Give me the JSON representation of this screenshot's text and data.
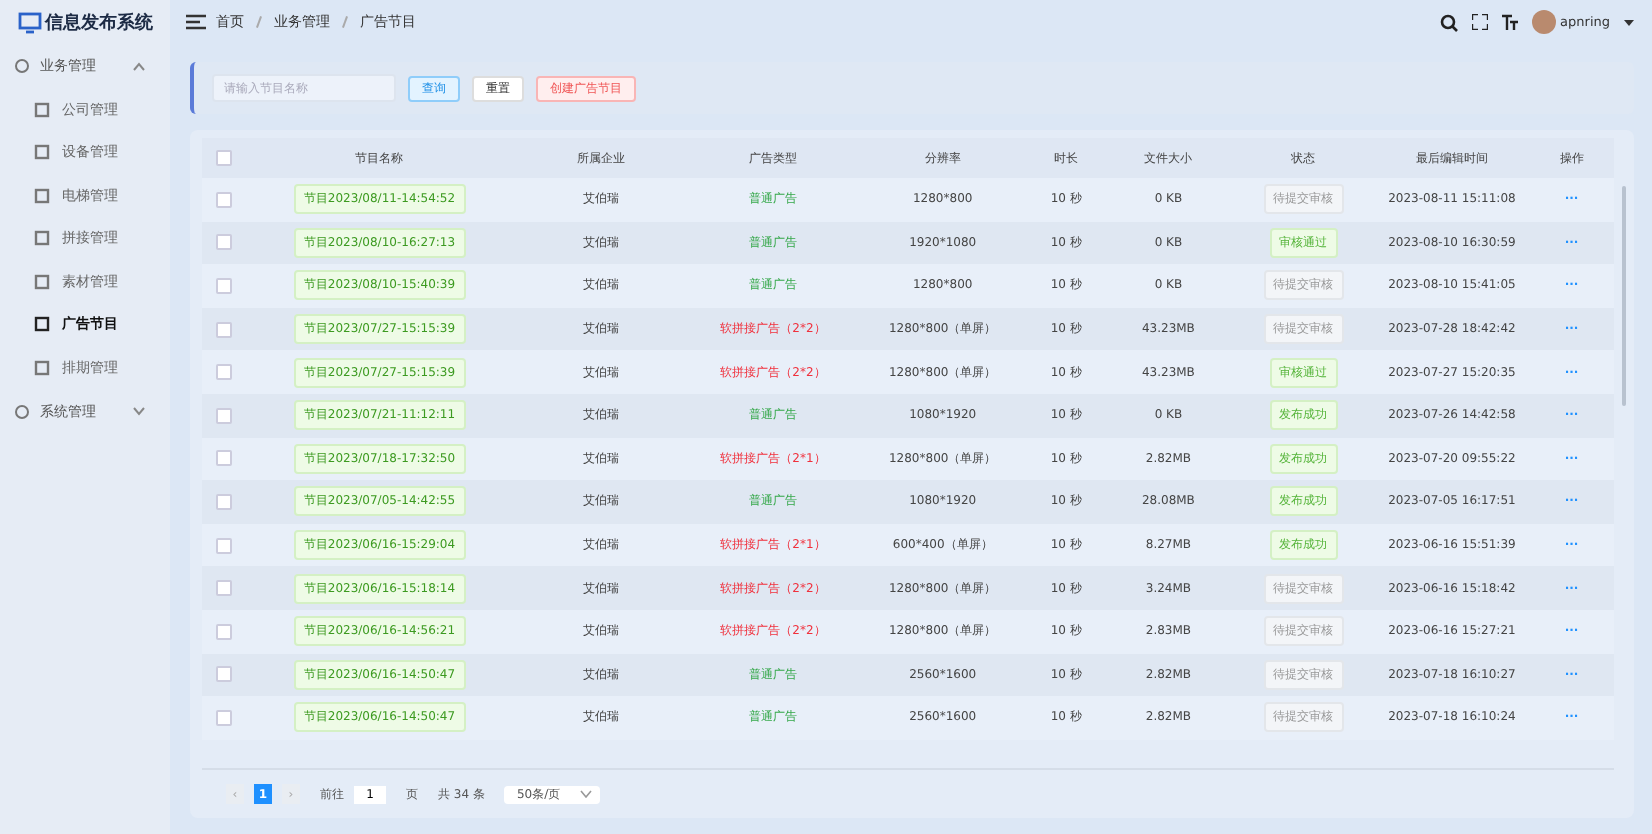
{
  "sidebar": {
    "title": "信息发布系统",
    "groups": [
      {
        "label": "业务管理",
        "expanded": true,
        "items": [
          {
            "label": "公司管理",
            "selected": false
          },
          {
            "label": "设备管理",
            "selected": false
          },
          {
            "label": "电梯管理",
            "selected": false
          },
          {
            "label": "拼接管理",
            "selected": false
          },
          {
            "label": "素材管理",
            "selected": false
          },
          {
            "label": "广告节目",
            "selected": true
          },
          {
            "label": "排期管理",
            "selected": false
          }
        ]
      },
      {
        "label": "系统管理",
        "expanded": false
      }
    ]
  },
  "header": {
    "breadcrumb": [
      "首页",
      "业务管理",
      "广告节目"
    ],
    "user": "apnring"
  },
  "search": {
    "placeholder": "请输入节目名称",
    "buttons": [
      {
        "kind": "query",
        "label": "查询"
      },
      {
        "kind": "reset",
        "label": "重置"
      },
      {
        "kind": "create",
        "label": "创建广告节目"
      }
    ]
  },
  "table": {
    "select_all_checked": false,
    "columns": [
      "节目名称",
      "所属企业",
      "广告类型",
      "分辨率",
      "时长",
      "文件大小",
      "状态",
      "最后编辑时间",
      "操作"
    ],
    "rows": [
      {
        "name": "节目2023/08/11-14:54:52",
        "company": "艾伯瑞",
        "ad_type": {
          "label": "普通广告",
          "kind": "normal"
        },
        "resolution": "1280*800",
        "duration": "10 秒",
        "size": "0 KB",
        "status": {
          "label": "待提交审核",
          "kind": "pending"
        },
        "edited": "2023-08-11 15:11:08",
        "action": "···",
        "checked": false
      },
      {
        "name": "节目2023/08/10-16:27:13",
        "company": "艾伯瑞",
        "ad_type": {
          "label": "普通广告",
          "kind": "normal"
        },
        "resolution": "1920*1080",
        "duration": "10 秒",
        "size": "0 KB",
        "status": {
          "label": "审核通过",
          "kind": "approved"
        },
        "edited": "2023-08-10 16:30:59",
        "action": "···",
        "checked": false
      },
      {
        "name": "节目2023/08/10-15:40:39",
        "company": "艾伯瑞",
        "ad_type": {
          "label": "普通广告",
          "kind": "normal"
        },
        "resolution": "1280*800",
        "duration": "10 秒",
        "size": "0 KB",
        "status": {
          "label": "待提交审核",
          "kind": "pending"
        },
        "edited": "2023-08-10 15:41:05",
        "action": "···",
        "checked": false
      },
      {
        "name": "节目2023/07/27-15:15:39",
        "company": "艾伯瑞",
        "ad_type": {
          "label": "软拼接广告（2*2）",
          "kind": "split"
        },
        "resolution": "1280*800（单屏）",
        "duration": "10 秒",
        "size": "43.23MB",
        "status": {
          "label": "待提交审核",
          "kind": "pending"
        },
        "edited": "2023-07-28 18:42:42",
        "action": "···",
        "checked": false
      },
      {
        "name": "节目2023/07/27-15:15:39",
        "company": "艾伯瑞",
        "ad_type": {
          "label": "软拼接广告（2*2）",
          "kind": "split"
        },
        "resolution": "1280*800（单屏）",
        "duration": "10 秒",
        "size": "43.23MB",
        "status": {
          "label": "审核通过",
          "kind": "approved"
        },
        "edited": "2023-07-27 15:20:35",
        "action": "···",
        "checked": false
      },
      {
        "name": "节目2023/07/21-11:12:11",
        "company": "艾伯瑞",
        "ad_type": {
          "label": "普通广告",
          "kind": "normal"
        },
        "resolution": "1080*1920",
        "duration": "10 秒",
        "size": "0 KB",
        "status": {
          "label": "发布成功",
          "kind": "published"
        },
        "edited": "2023-07-26 14:42:58",
        "action": "···",
        "checked": false
      },
      {
        "name": "节目2023/07/18-17:32:50",
        "company": "艾伯瑞",
        "ad_type": {
          "label": "软拼接广告（2*1）",
          "kind": "split"
        },
        "resolution": "1280*800（单屏）",
        "duration": "10 秒",
        "size": "2.82MB",
        "status": {
          "label": "发布成功",
          "kind": "published"
        },
        "edited": "2023-07-20 09:55:22",
        "action": "···",
        "checked": false
      },
      {
        "name": "节目2023/07/05-14:42:55",
        "company": "艾伯瑞",
        "ad_type": {
          "label": "普通广告",
          "kind": "normal"
        },
        "resolution": "1080*1920",
        "duration": "10 秒",
        "size": "28.08MB",
        "status": {
          "label": "发布成功",
          "kind": "published"
        },
        "edited": "2023-07-05 16:17:51",
        "action": "···",
        "checked": false
      },
      {
        "name": "节目2023/06/16-15:29:04",
        "company": "艾伯瑞",
        "ad_type": {
          "label": "软拼接广告（2*1）",
          "kind": "split"
        },
        "resolution": "600*400（单屏）",
        "duration": "10 秒",
        "size": "8.27MB",
        "status": {
          "label": "发布成功",
          "kind": "published"
        },
        "edited": "2023-06-16 15:51:39",
        "action": "···",
        "checked": false
      },
      {
        "name": "节目2023/06/16-15:18:14",
        "company": "艾伯瑞",
        "ad_type": {
          "label": "软拼接广告（2*2）",
          "kind": "split"
        },
        "resolution": "1280*800（单屏）",
        "duration": "10 秒",
        "size": "3.24MB",
        "status": {
          "label": "待提交审核",
          "kind": "pending"
        },
        "edited": "2023-06-16 15:18:42",
        "action": "···",
        "checked": false
      },
      {
        "name": "节目2023/06/16-14:56:21",
        "company": "艾伯瑞",
        "ad_type": {
          "label": "软拼接广告（2*2）",
          "kind": "split"
        },
        "resolution": "1280*800（单屏）",
        "duration": "10 秒",
        "size": "2.83MB",
        "status": {
          "label": "待提交审核",
          "kind": "pending"
        },
        "edited": "2023-06-16 15:27:21",
        "action": "···",
        "checked": false
      },
      {
        "name": "节目2023/06/16-14:50:47",
        "company": "艾伯瑞",
        "ad_type": {
          "label": "普通广告",
          "kind": "normal"
        },
        "resolution": "2560*1600",
        "duration": "10 秒",
        "size": "2.82MB",
        "status": {
          "label": "待提交审核",
          "kind": "pending"
        },
        "edited": "2023-07-18 16:10:27",
        "action": "···",
        "checked": false
      },
      {
        "name": "节目2023/06/16-14:50:47",
        "company": "艾伯瑞",
        "ad_type": {
          "label": "普通广告",
          "kind": "normal"
        },
        "resolution": "2560*1600",
        "duration": "10 秒",
        "size": "2.82MB",
        "status": {
          "label": "待提交审核",
          "kind": "pending"
        },
        "edited": "2023-07-18 16:10:24",
        "action": "···",
        "checked": false
      }
    ]
  },
  "pagination": {
    "prev": "‹",
    "pages": [
      {
        "label": "1",
        "selected": true
      }
    ],
    "next": "›",
    "goto_label": "前往",
    "goto_value": "1",
    "goto_suffix": "页",
    "total": "共 34 条",
    "page_size": "50条/页"
  }
}
